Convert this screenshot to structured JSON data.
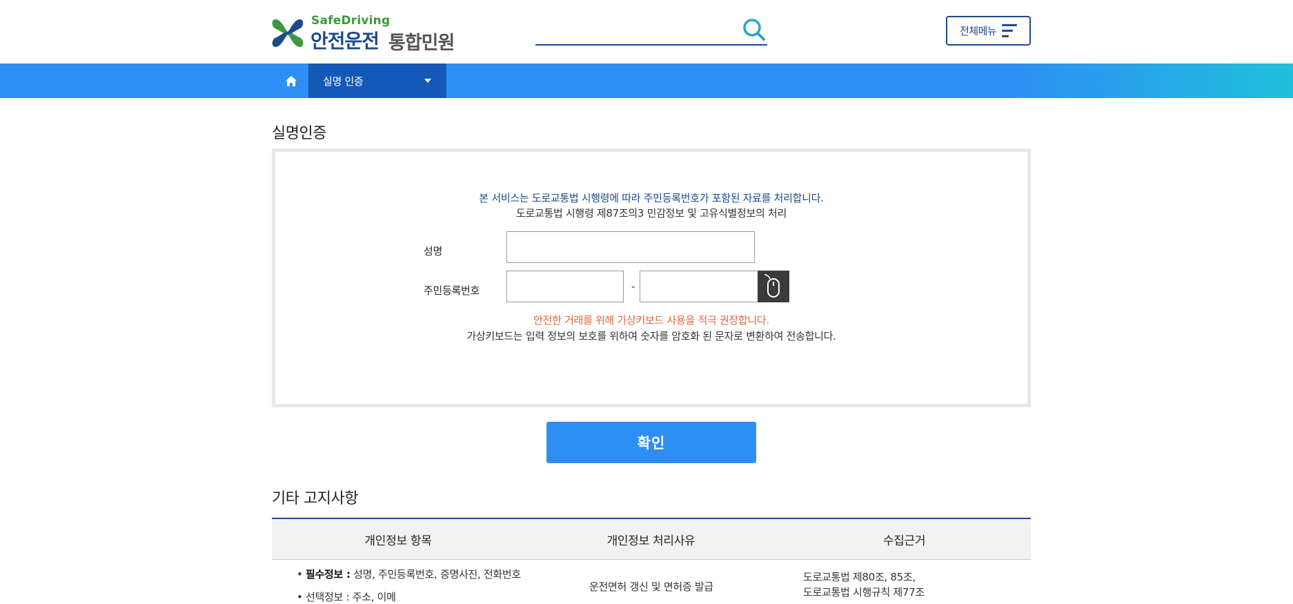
{
  "header": {
    "logo_en": "SafeDriving",
    "logo_ko_primary": "안전운전",
    "logo_ko_secondary": "통합민원",
    "search_placeholder": "",
    "all_menu_label": "전체메뉴"
  },
  "nav": {
    "home_icon": "home-icon",
    "current_label": "실명 인증"
  },
  "main": {
    "title": "실명인증",
    "notice_line1": "본 서비스는 도로교통법 시행령에 따라 주민등록번호가 포함된 자료를 처리합니다.",
    "notice_line2": "도로교통법 시행령 제87조의3 민감정보 및 고유식별정보의 처리",
    "name_label": "성명",
    "name_value": "",
    "rrn_label": "주민등록번호",
    "rrn_front_value": "",
    "rrn_back_value": "",
    "rrn_separator": "-",
    "keyboard_icon": "mouse-icon",
    "warning": "안전한 거래를 위해 가상키보드 사용을 적극 권장합니다.",
    "keyboard_note": "가상키보드는 입력 정보의 보호를 위하여 숫자를 암호화 된 문자로 변환하여 전송합니다.",
    "confirm_label": "확인"
  },
  "other": {
    "title": "기타 고지사항",
    "columns": [
      "개인정보 항목",
      "개인정보 처리사유",
      "수집근거"
    ],
    "row": {
      "required_label": "필수정보 :",
      "required_items": "성명, 주민등록번호, 증명사진, 전화번호",
      "optional_partial": "선택정보 : 주소, 이메",
      "purpose": "운전면허 갱신 및 면허증 발급",
      "basis_line1": "도로교통법 제80조, 85조,",
      "basis_line2": "도로교통법 시행규칙 제77조"
    }
  },
  "colors": {
    "brand_navy": "#1e4a8c",
    "brand_green": "#3a9a3d",
    "nav_blue": "#2d8ff4",
    "nav_active": "#1458b8",
    "warning": "#e0653c"
  }
}
